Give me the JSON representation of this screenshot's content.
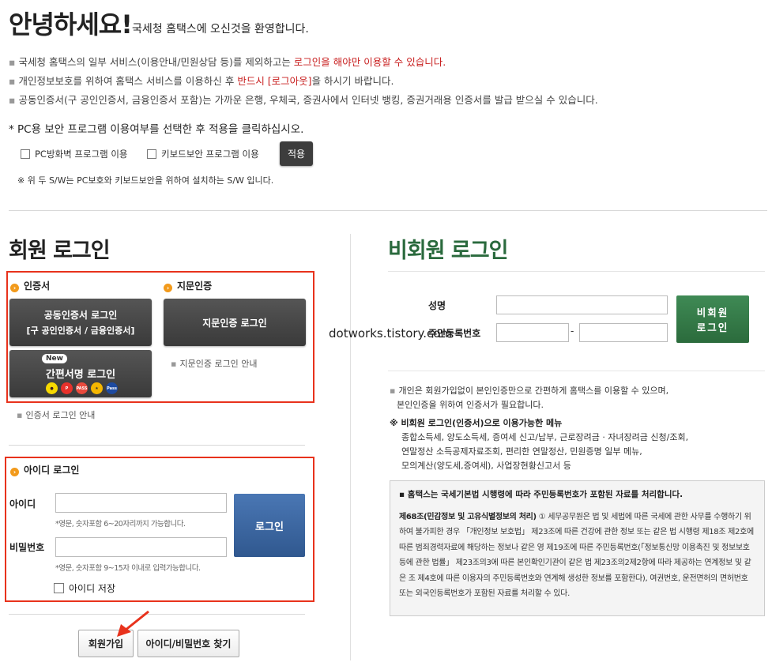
{
  "header": {
    "greeting": "안녕하세요!",
    "welcome": "국세청 홈택스에 오신것을 환영합니다."
  },
  "notices": [
    {
      "pre": "국세청 홈택스의 일부 서비스(이용안내/민원상담 등)를 제외하고는 ",
      "red": "로그인을 해야만 이용할 수 있습니다.",
      "post": ""
    },
    {
      "pre": "개인정보보호를 위하여 홈택스 서비스를 이용하신 후 ",
      "red": "반드시 [로그아웃]",
      "post": "을 하시기 바랍니다."
    },
    {
      "pre": "공동인증서(구 공인인증서, 금융인증서 포함)는 가까운 은행, 우체국, 증권사에서 인터넷 뱅킹, 증권거래용 인증서를 발급 받으실 수 있습니다.",
      "red": "",
      "post": ""
    }
  ],
  "pc_security": {
    "title": "* PC용 보안 프로그램 이용여부를 선택한 후 적용을 클릭하십시오.",
    "option_firewall": "PC방화벽 프로그램 이용",
    "option_keyboard": "키보드보안 프로그램 이용",
    "apply": "적용",
    "note": "※ 위 두 S/W는 PC보호와 키보드보안을 위하여 설치하는 S/W 입니다."
  },
  "member": {
    "title": "회원 로그인",
    "cert_head": "인증서",
    "bio_head": "지문인증",
    "joint_cert_btn": "공동인증서 로그인",
    "joint_cert_sub": "[구 공인인증서 / 금융인증서]",
    "bio_btn": "지문인증 로그인",
    "bio_guide": "지문인증 로그인 안내",
    "simple_badge": "New",
    "simple_btn": "간편서명 로그인",
    "pay_icons": [
      "kakao-icon",
      "payco-icon",
      "pass-icon",
      "kb-icon",
      "naver-icon"
    ],
    "cert_guide": "인증서 로그인 안내",
    "id_head": "아이디 로그인",
    "id_label": "아이디",
    "id_hint": "*영문, 숫자포함 6~20자리까지 가능합니다.",
    "pw_label": "비밀번호",
    "pw_hint": "*영문, 숫자포함 9~15자 이내로 입력가능합니다.",
    "login_btn": "로그인",
    "save_id": "아이디 저장",
    "join_btn": "회원가입",
    "find_btn": "아이디/비밀번호 찾기"
  },
  "guest": {
    "title": "비회원 로그인",
    "name_label": "성명",
    "rrn_label": "주민등록번호",
    "rrn_dash": "-",
    "btn_line1": "비회원",
    "btn_line2": "로그인",
    "desc1": "개인은 회원가입없이 본인인증만으로 간편하게 홈택스를 이용할 수 있으며,",
    "desc2": "본인인증을 위하여 인증서가 필요합니다.",
    "menu_title": "※ 비회원 로그인(인증서)으로 이용가능한 메뉴",
    "menu_lines": [
      "종합소득세, 양도소득세, 증여세 신고/납부, 근로장려금 · 자녀장려금 신청/조회,",
      "연말정산 소득공제자료조회, 편리한 연말정산, 민원증명 일부 메뉴,",
      "모의계산(양도세,증여세), 사업장현황신고서 등"
    ],
    "info_title": "홈택스는 국세기본법 시행령에 따라 주민등록번호가 포함된 자료를 처리합니다.",
    "info_bold": "제68조(민감정보 및 고유식별정보의 처리)",
    "info_body": " ① 세무공무원은 법 및 세법에 따른 국세에 관한 사무를 수행하기 위하여 불가피한 경우 「개인정보 보호법」 제23조에 따른 건강에 관한 정보 또는 같은 법 시행령 제18조 제2호에 따른 범죄경력자료에 해당하는 정보나 같은 영 제19조에 따른 주민등록번호(「정보통신망 이용촉진 및 정보보호 등에 관한 법률」 제23조의3에 따른 본인확인기관이 같은 법 제23조의2제2항에 따라 제공하는 연계정보 및 같은 조 제4호에 따른 이용자의 주민등록번호와 연계해 생성한 정보를 포함한다), 여권번호, 운전면허의 면허번호 또는 외국인등록번호가 포함된 자료를 처리할 수 있다."
  },
  "watermark": "dotworks.tistory.com"
}
